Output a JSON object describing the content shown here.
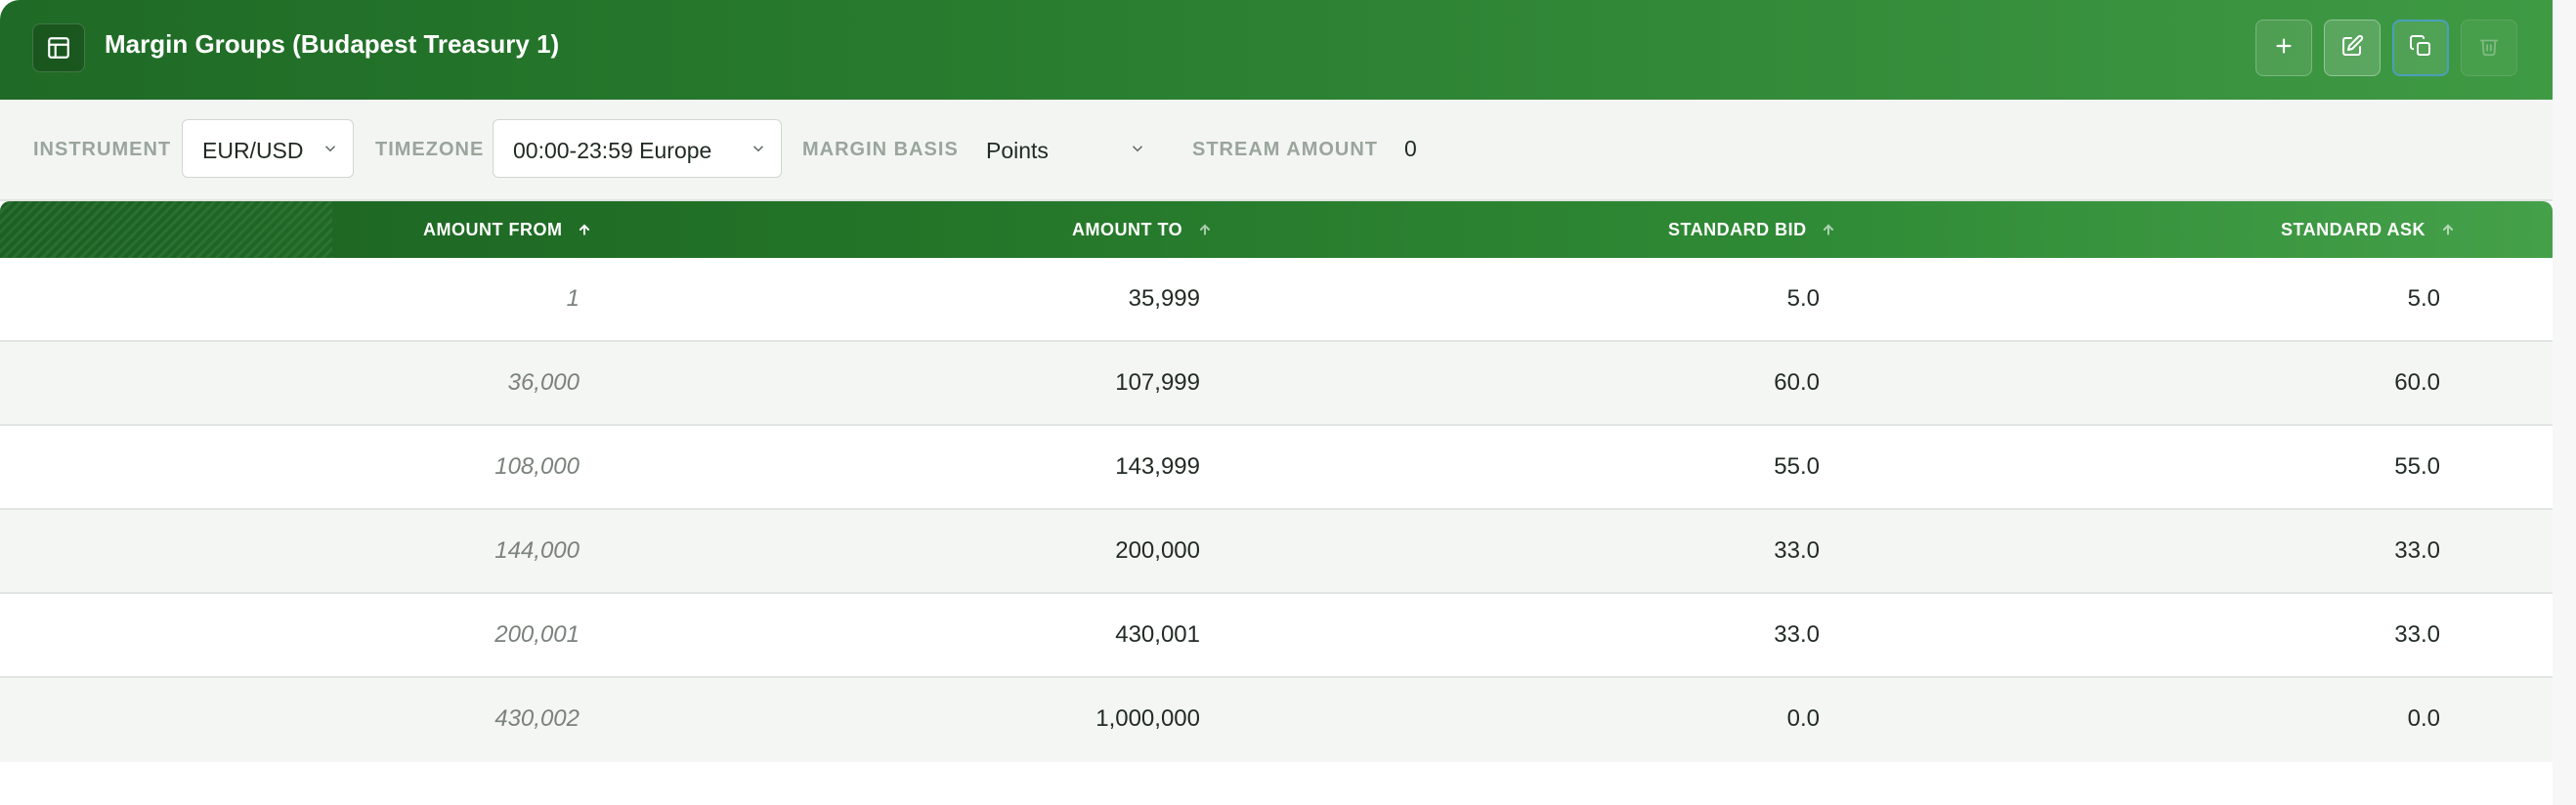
{
  "window": {
    "title": "Margin Groups (Budapest Treasury 1)",
    "icons": {
      "title_icon": "layout-table-icon",
      "add": "plus-icon",
      "edit": "edit-icon",
      "duplicate": "copy-icon",
      "delete": "trash-icon"
    }
  },
  "filters": {
    "instrument": {
      "label": "INSTRUMENT",
      "value": "EUR/USD"
    },
    "timezone": {
      "label": "TIMEZONE",
      "value": "00:00-23:59 Europe"
    },
    "margin_basis": {
      "label": "MARGIN BASIS",
      "value": "Points"
    },
    "stream_amount": {
      "label": "STREAM AMOUNT",
      "value": "0"
    }
  },
  "table": {
    "columns": [
      "AMOUNT FROM",
      "AMOUNT TO",
      "STANDARD BID",
      "STANDARD ASK"
    ],
    "rows": [
      {
        "from": "1",
        "to": "35,999",
        "bid": "5.0",
        "ask": "5.0"
      },
      {
        "from": "36,000",
        "to": "107,999",
        "bid": "60.0",
        "ask": "60.0"
      },
      {
        "from": "108,000",
        "to": "143,999",
        "bid": "55.0",
        "ask": "55.0"
      },
      {
        "from": "144,000",
        "to": "200,000",
        "bid": "33.0",
        "ask": "33.0"
      },
      {
        "from": "200,001",
        "to": "430,001",
        "bid": "33.0",
        "ask": "33.0"
      },
      {
        "from": "430,002",
        "to": "1,000,000",
        "bid": "0.0",
        "ask": "0.0"
      }
    ]
  },
  "colors": {
    "header_green": "#2a7f30",
    "header_green_dark": "#1f6a26",
    "header_green_light": "#3f9a44",
    "text_muted": "#9aa59c",
    "row_alt": "#f4f6f4"
  }
}
